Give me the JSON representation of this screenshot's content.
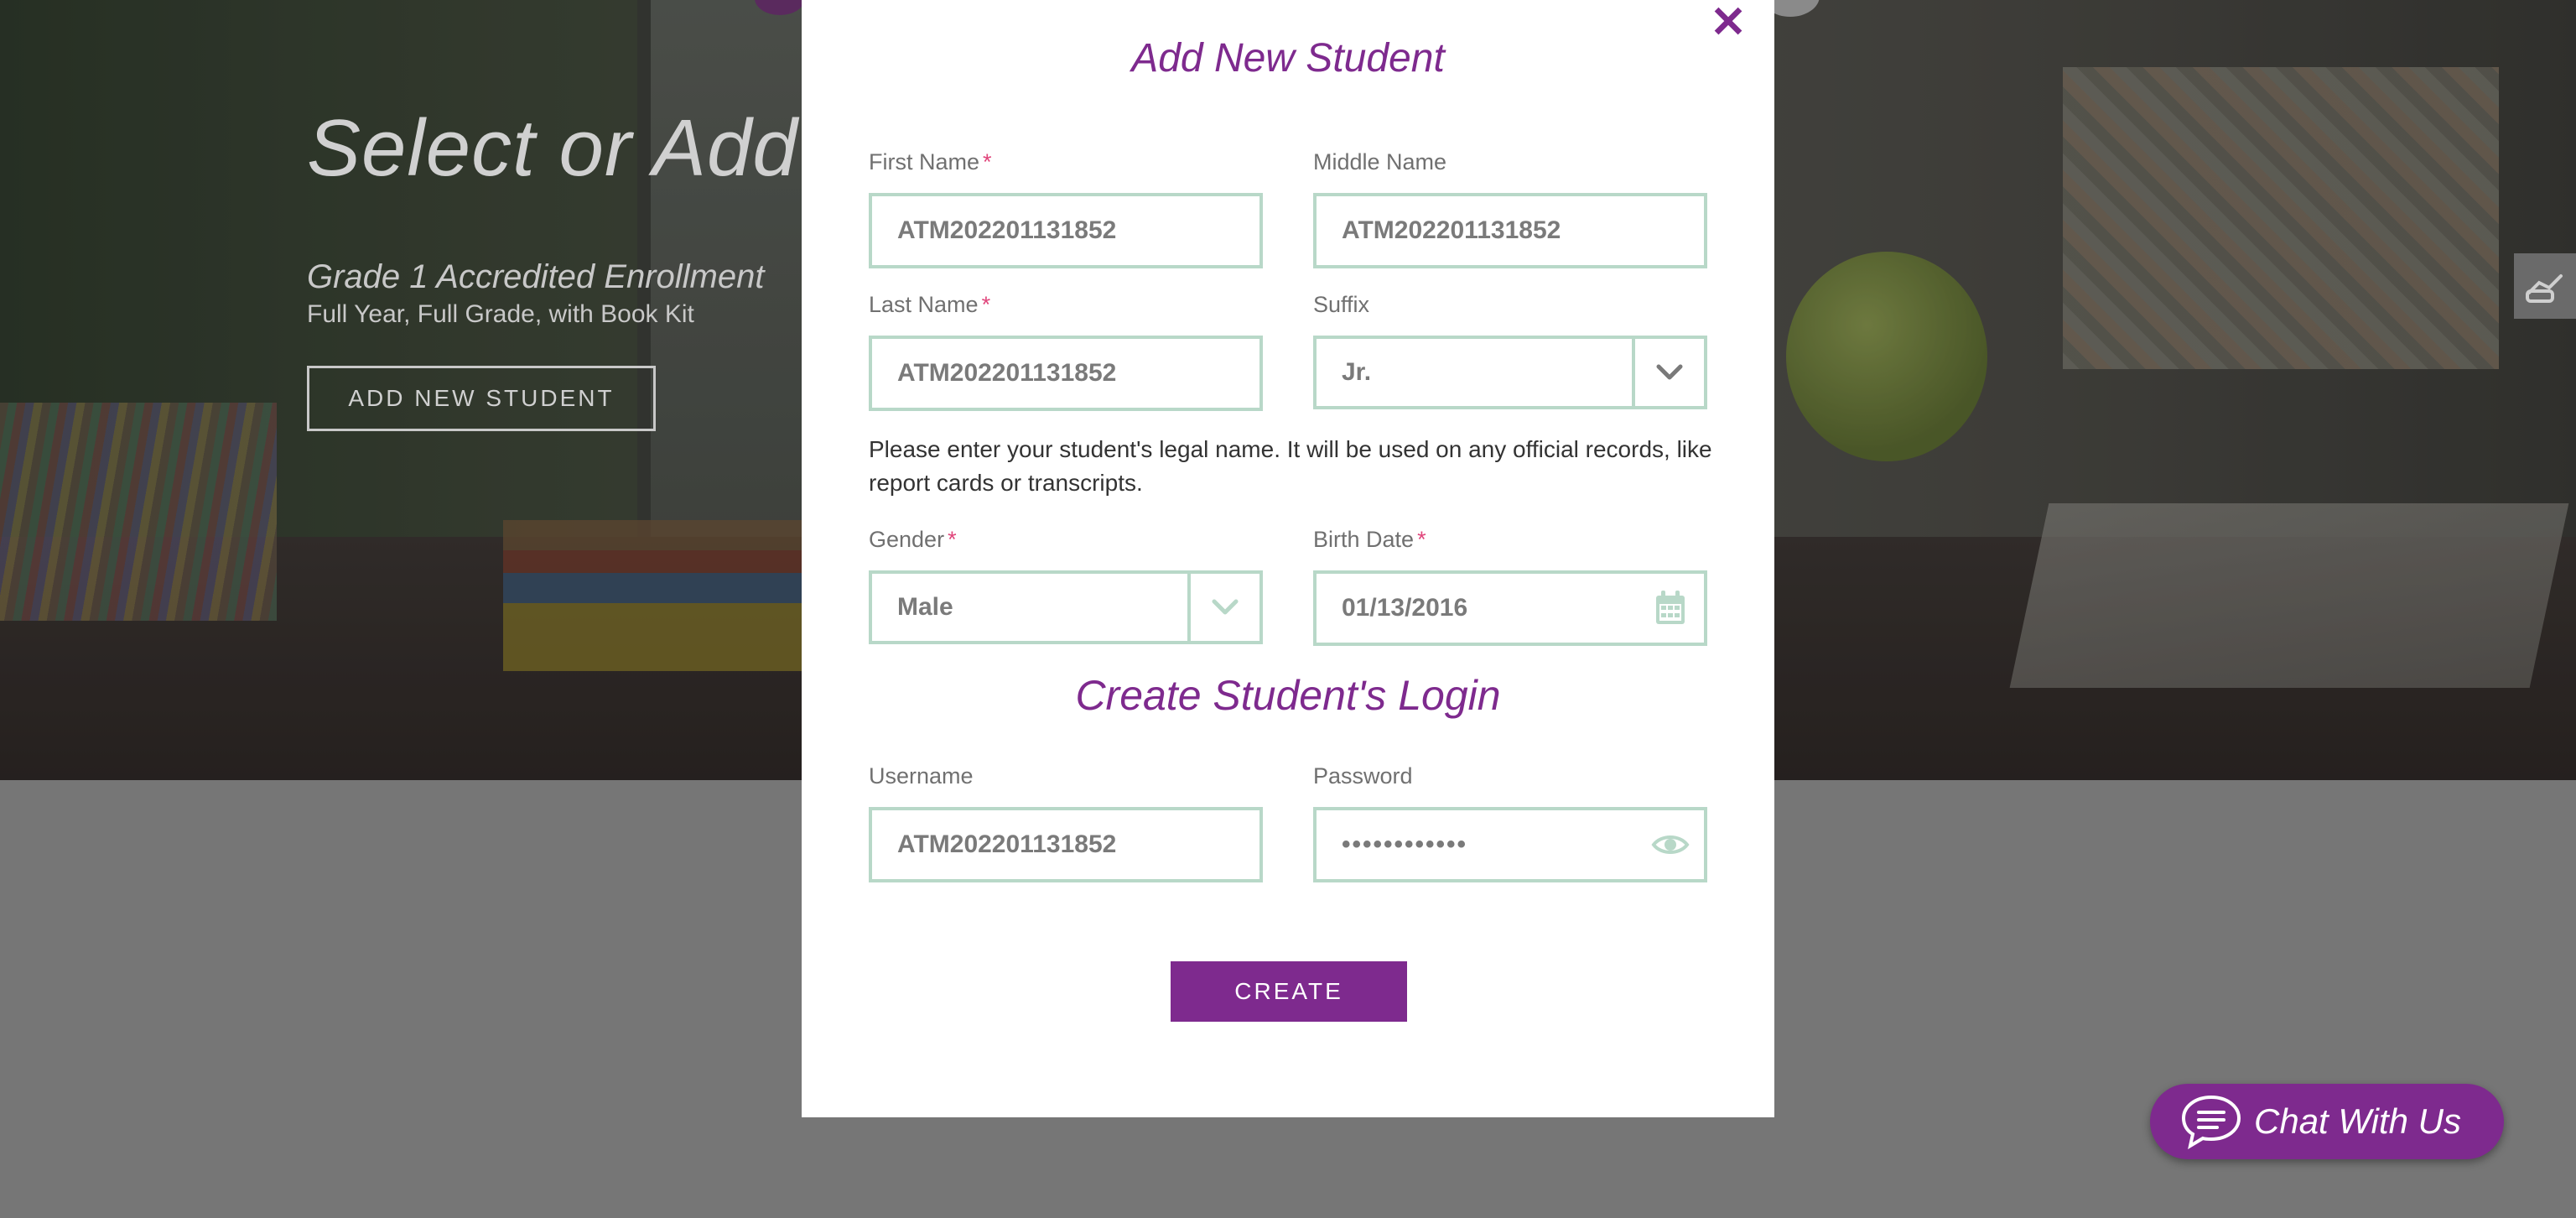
{
  "hero": {
    "title": "Select or Add",
    "course_title": "Grade 1 Accredited Enrollment",
    "course_subtitle": "Full Year, Full Grade, with Book Kit",
    "add_button": "ADD NEW STUDENT"
  },
  "modal": {
    "close_symbol": "✕",
    "title": "Add New Student",
    "fields": {
      "first_name": {
        "label": "First Name",
        "required": "*",
        "value": "ATM202201131852"
      },
      "middle_name": {
        "label": "Middle Name",
        "value": "ATM202201131852"
      },
      "last_name": {
        "label": "Last Name",
        "required": "*",
        "value": "ATM202201131852"
      },
      "suffix": {
        "label": "Suffix",
        "value": "Jr."
      },
      "gender": {
        "label": "Gender",
        "required": "*",
        "value": "Male"
      },
      "birth_date": {
        "label": "Birth Date",
        "required": "*",
        "value": "01/13/2016"
      }
    },
    "helper_text": "Please enter your student's legal name. It will be used on any official records, like report cards or transcripts.",
    "login_section_title": "Create Student's Login",
    "login": {
      "username": {
        "label": "Username",
        "value": "ATM202201131852"
      },
      "password": {
        "label": "Password",
        "value": "••••••••••••"
      }
    },
    "create_button": "CREATE"
  },
  "chat": {
    "label": "Chat With Us"
  },
  "icons": {
    "close": "close-icon",
    "chevron": "chevron-down-icon",
    "calendar": "calendar-icon",
    "eye": "eye-icon",
    "chat": "chat-bubble-icon",
    "side_tab": "hand-icon"
  },
  "colors": {
    "brand_purple": "#7e2a8e",
    "field_border": "#b8d8c8",
    "required": "#e0457b",
    "overlay_gray": "#767676"
  }
}
